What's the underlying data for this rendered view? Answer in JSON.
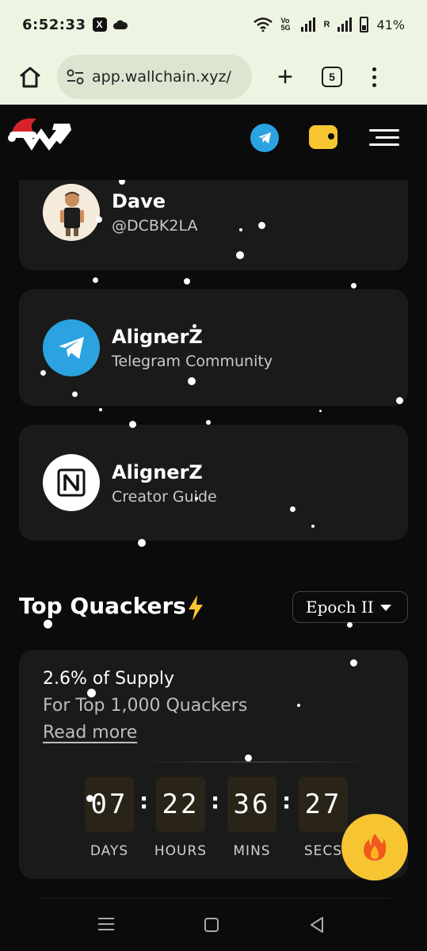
{
  "status_bar": {
    "time": "6:52:33",
    "x_badge": "X",
    "network_label": "Vo 5G",
    "roaming": "R",
    "battery": "41%"
  },
  "browser": {
    "url": "app.wallchain.xyz/",
    "tab_count": "5",
    "plus_label": "+"
  },
  "header": {
    "logo_icon": "wallchain-logo-with-santa-hat",
    "telegram_icon": "telegram-icon",
    "wallet_icon": "wallet-icon",
    "menu_icon": "hamburger-menu-icon"
  },
  "profile_card": {
    "name": "Dave",
    "handle": "@DCBK2LA"
  },
  "telegram_card": {
    "title": "AlignerZ",
    "subtitle": "Telegram Community"
  },
  "notion_card": {
    "title": "AlignerZ",
    "subtitle": "Creator Guide"
  },
  "top_quackers": {
    "title": "Top Quackers",
    "epoch_selected": "Epoch II",
    "supply_text": "2.6% of Supply",
    "supply_sub": "For Top 1,000 Quackers",
    "read_more": "Read more",
    "countdown": {
      "days": "07",
      "hours": "22",
      "mins": "36",
      "secs": "27",
      "days_label": "DAYS",
      "hours_label": "HOURS",
      "mins_label": "MINS",
      "secs_label": "SECS"
    }
  },
  "colors": {
    "accent_yellow": "#f6c531",
    "telegram_blue": "#2aa3e0",
    "card_bg": "#1a1a1a",
    "page_bg": "#0b0b0b"
  }
}
